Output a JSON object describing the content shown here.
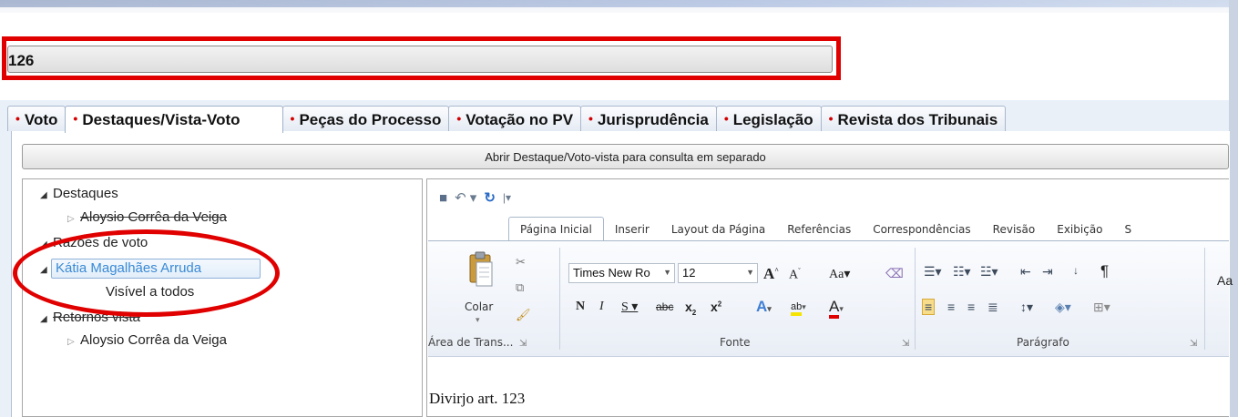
{
  "process": {
    "number": "126"
  },
  "tabs": [
    {
      "label": "Voto",
      "active": false
    },
    {
      "label": "Destaques/Vista-Voto",
      "active": true
    },
    {
      "label": "Peças do Processo",
      "active": false
    },
    {
      "label": "Votação no PV",
      "active": false
    },
    {
      "label": "Jurisprudência",
      "active": false
    },
    {
      "label": "Legislação",
      "active": false
    },
    {
      "label": "Revista dos Tribunais",
      "active": false
    }
  ],
  "tab_marker": "•",
  "open_button": {
    "label": "Abrir Destaque/Voto-vista para consulta em separado"
  },
  "tree": {
    "destaques": {
      "label": "Destaques",
      "child": "Aloysio Corrêa da Veiga"
    },
    "razoes": {
      "label": "Razões de voto",
      "child": "Kátia Magalhães Arruda",
      "grandchild": "Visível a todos"
    },
    "retornos": {
      "label": "Retornos vista",
      "child": "Aloysio Corrêa da Veiga"
    }
  },
  "word": {
    "ribbon_tabs": [
      "Página Inicial",
      "Inserir",
      "Layout da Página",
      "Referências",
      "Correspondências",
      "Revisão",
      "Exibição",
      "S"
    ],
    "clipboard": {
      "paste_label": "Colar",
      "group_label": "Área de Trans..."
    },
    "font": {
      "name": "Times New Ro",
      "size": "12",
      "group_label": "Fonte"
    },
    "paragraph": {
      "group_label": "Parágrafo"
    },
    "styles_label": "Aa",
    "document_text": "Divirjo art. 123"
  },
  "colors": {
    "highlight_red": "#e00000",
    "tab_marker_red": "#d40000",
    "selected_text_blue": "#3a8ad6"
  }
}
